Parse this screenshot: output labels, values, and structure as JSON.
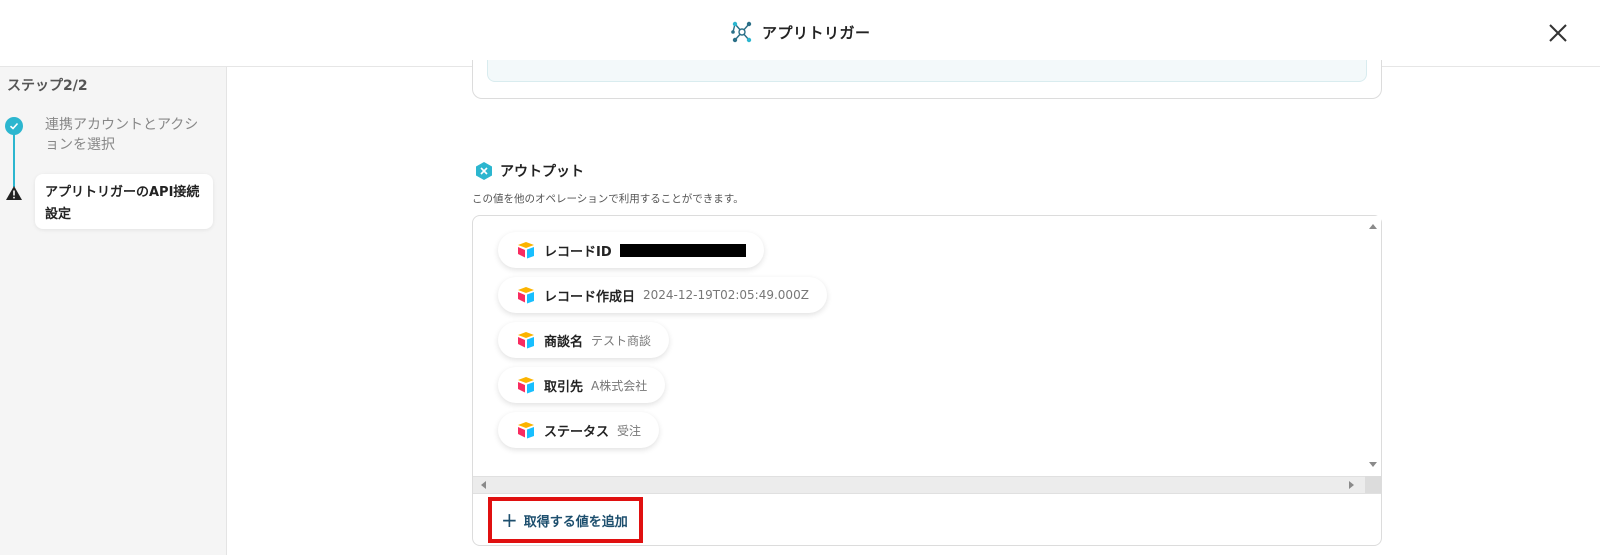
{
  "header": {
    "title": "アプリトリガー",
    "icon": "network-nodes-icon",
    "close_icon": "close-icon"
  },
  "sidebar": {
    "step_label": "ステップ2/2",
    "steps": [
      {
        "label": "連携アカウントとアクションを選択",
        "status": "completed",
        "icon": "check-icon"
      },
      {
        "label": "アプリトリガーのAPI接続設定",
        "status": "warning",
        "icon": "warning-icon"
      }
    ]
  },
  "output": {
    "title": "アウトプット",
    "description": "この値を他のオペレーションで利用することができます。",
    "items": [
      {
        "label": "レコードID",
        "value": "",
        "redacted": true
      },
      {
        "label": "レコード作成日",
        "value": "2024-12-19T02:05:49.000Z"
      },
      {
        "label": "商談名",
        "value": "テスト商談"
      },
      {
        "label": "取引先",
        "value": "A株式会社"
      },
      {
        "label": "ステータス",
        "value": "受注"
      }
    ],
    "add_button_label": "取得する値を追加"
  },
  "colors": {
    "accent": "#2cb6cf",
    "highlight_border": "#e01010",
    "link_text": "#1d4f6e"
  }
}
